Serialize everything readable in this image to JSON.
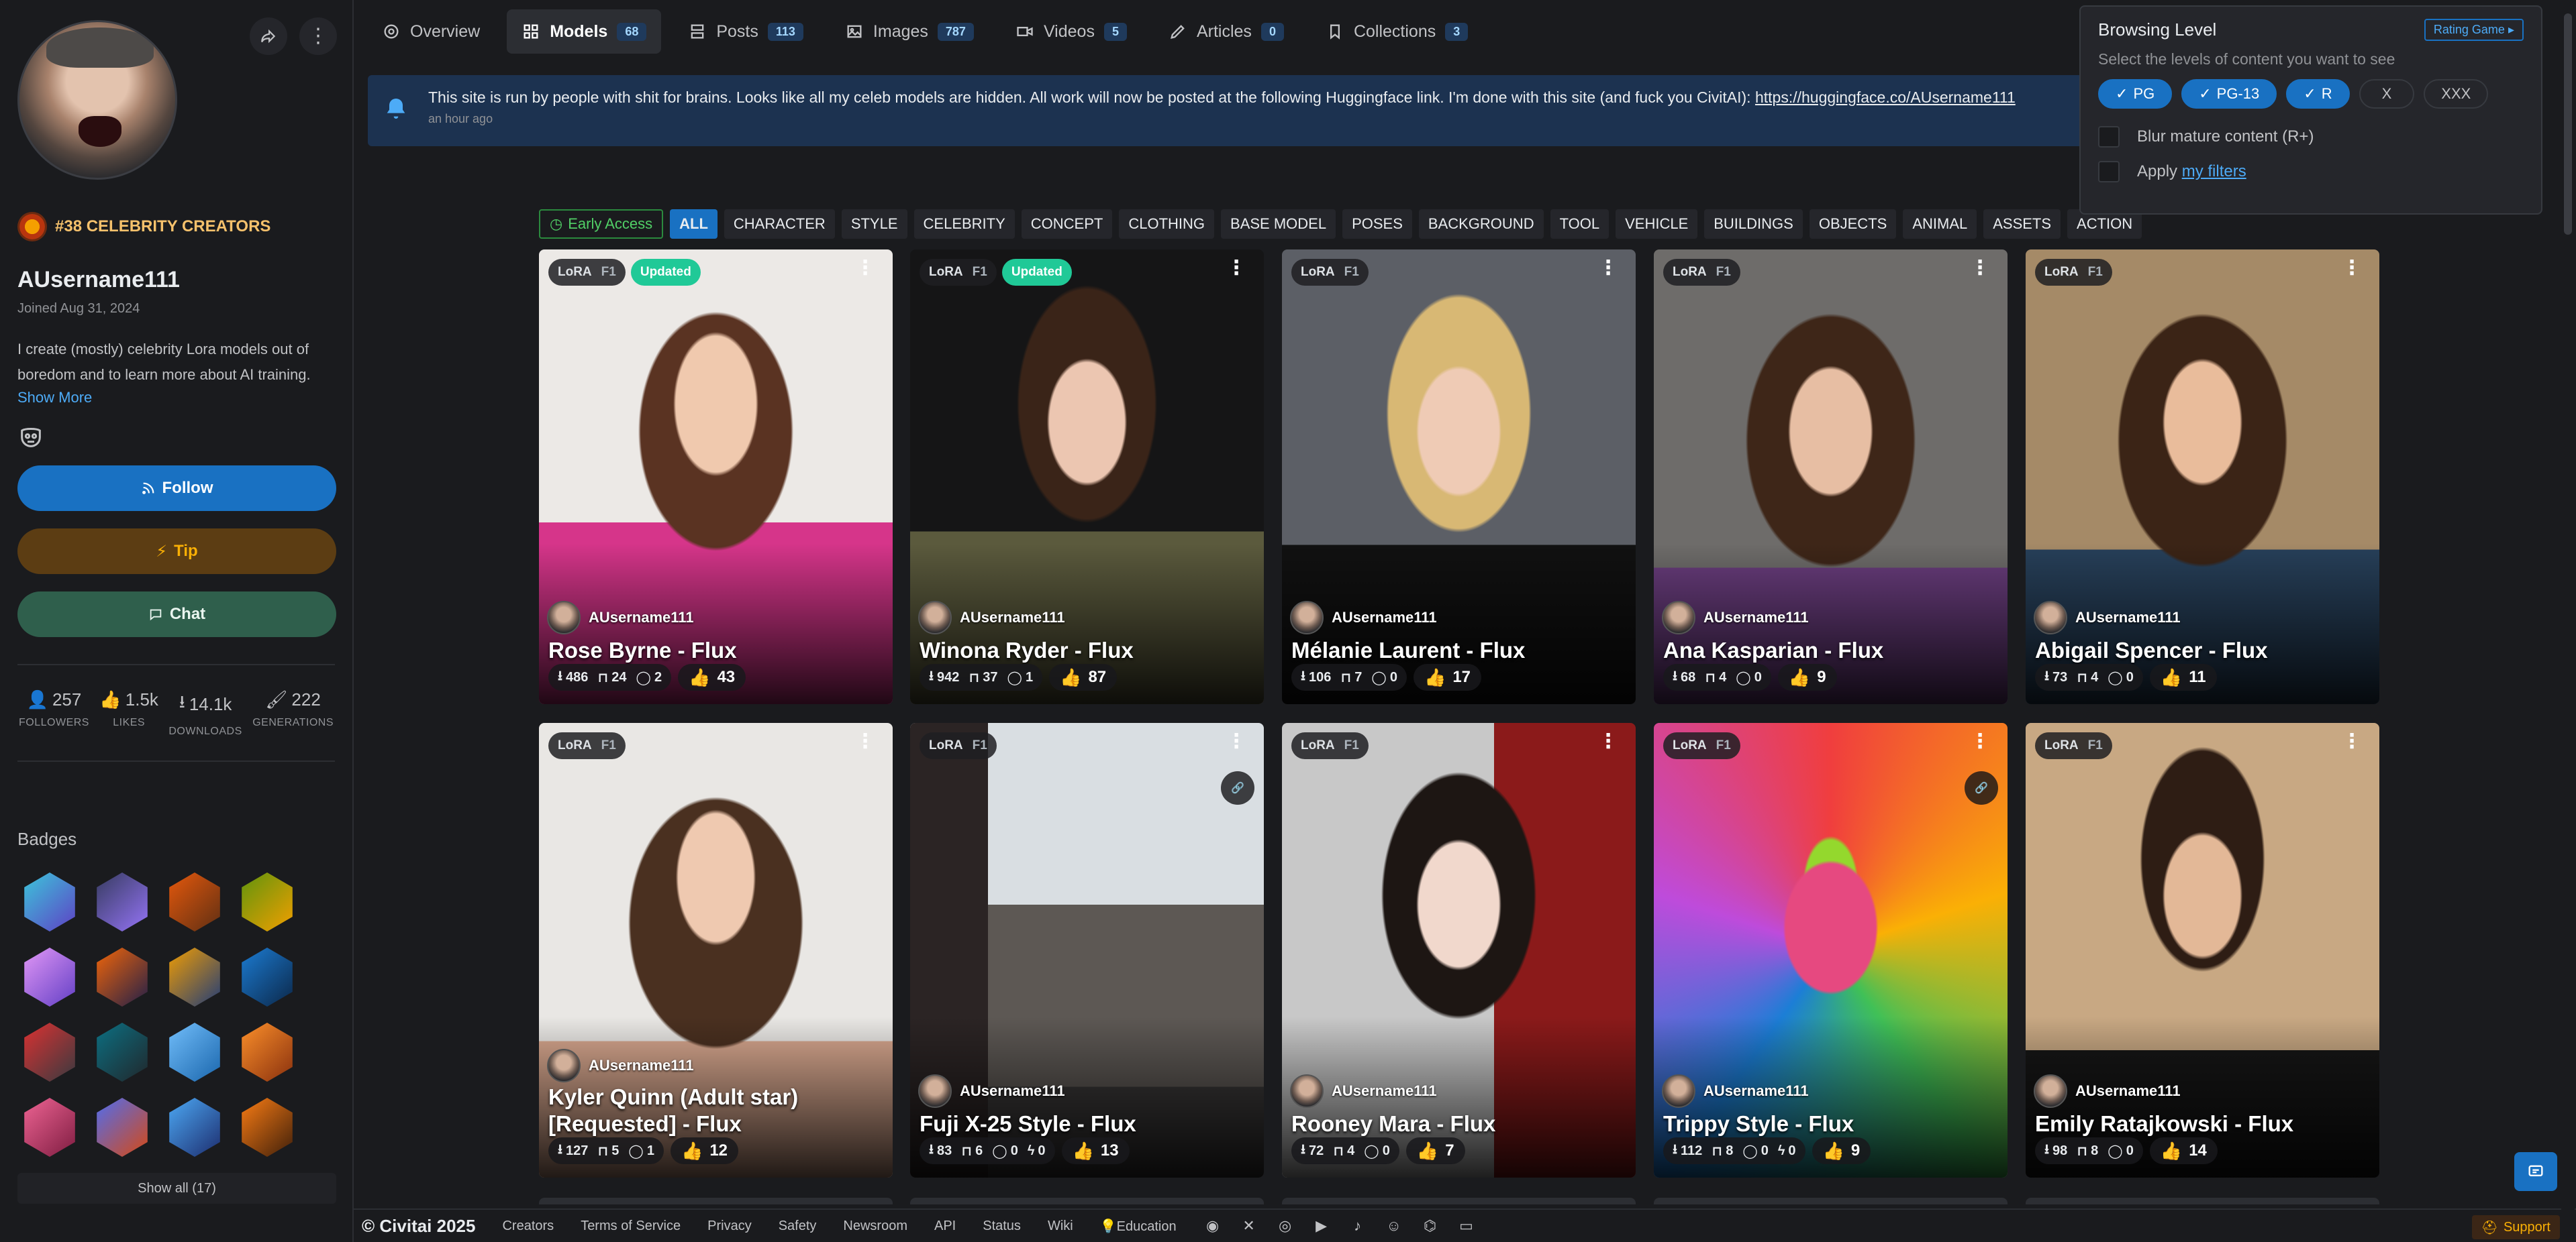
{
  "profile": {
    "rank": "#38 CELEBRITY CREATORS",
    "username": "AUsername111",
    "joined": "Joined Aug 31, 2024",
    "bio": "I create (mostly) celebrity Lora models out of boredom and to learn more about AI training.",
    "show_more": "Show More",
    "follow": "Follow",
    "tip": "Tip",
    "chat": "Chat",
    "stats": [
      {
        "value": "257",
        "label": "FOLLOWERS"
      },
      {
        "value": "1.5k",
        "label": "LIKES"
      },
      {
        "value": "14.1k",
        "label": "DOWNLOADS"
      },
      {
        "value": "222",
        "label": "GENERATIONS"
      }
    ],
    "badges_title": "Badges",
    "show_all": "Show all (17)"
  },
  "tabs": [
    {
      "label": "Overview",
      "count": ""
    },
    {
      "label": "Models",
      "count": "68"
    },
    {
      "label": "Posts",
      "count": "113"
    },
    {
      "label": "Images",
      "count": "787"
    },
    {
      "label": "Videos",
      "count": "5"
    },
    {
      "label": "Articles",
      "count": "0"
    },
    {
      "label": "Collections",
      "count": "3"
    }
  ],
  "announcement": {
    "message": "This site is run by people with shit for brains. Looks like all my celeb models are hidden. All work will now be posted at the following Huggingface link. I'm done with this site (and fuck you CivitAI): ",
    "link": "https://huggingface.co/AUsername111",
    "time": "an hour ago"
  },
  "filters": {
    "early_access": "Early Access",
    "chips": [
      "ALL",
      "CHARACTER",
      "STYLE",
      "CELEBRITY",
      "CONCEPT",
      "CLOTHING",
      "BASE MODEL",
      "POSES",
      "BACKGROUND",
      "TOOL",
      "VEHICLE",
      "BUILDINGS",
      "OBJECTS",
      "ANIMAL",
      "ASSETS",
      "ACTION"
    ]
  },
  "browsing": {
    "title": "Browsing Level",
    "rating_game": "Rating Game",
    "subtitle": "Select the levels of content you want to see",
    "levels": [
      "PG",
      "PG-13",
      "R",
      "X",
      "XXX"
    ],
    "blur": "Blur mature content (R+)",
    "apply": "Apply ",
    "my_filters": "my filters"
  },
  "cards": [
    {
      "type": "LoRA",
      "base": "F1",
      "updated": "Updated",
      "creator": "AUsername111",
      "title": "Rose Byrne - Flux",
      "downloads": "486",
      "bookmarks": "24",
      "comments": "2",
      "tips": "",
      "likes": "43"
    },
    {
      "type": "LoRA",
      "base": "F1",
      "updated": "Updated",
      "creator": "AUsername111",
      "title": "Winona Ryder - Flux",
      "downloads": "942",
      "bookmarks": "37",
      "comments": "1",
      "tips": "",
      "likes": "87"
    },
    {
      "type": "LoRA",
      "base": "F1",
      "updated": "",
      "creator": "AUsername111",
      "title": "Mélanie Laurent - Flux",
      "downloads": "106",
      "bookmarks": "7",
      "comments": "0",
      "tips": "",
      "likes": "17"
    },
    {
      "type": "LoRA",
      "base": "F1",
      "updated": "",
      "creator": "AUsername111",
      "title": "Ana Kasparian - Flux",
      "downloads": "68",
      "bookmarks": "4",
      "comments": "0",
      "tips": "",
      "likes": "9"
    },
    {
      "type": "LoRA",
      "base": "F1",
      "updated": "",
      "creator": "AUsername111",
      "title": "Abigail Spencer - Flux",
      "downloads": "73",
      "bookmarks": "4",
      "comments": "0",
      "tips": "",
      "likes": "11"
    },
    {
      "type": "LoRA",
      "base": "F1",
      "updated": "",
      "creator": "AUsername111",
      "title": "Kyler Quinn (Adult star) [Requested] - Flux",
      "downloads": "127",
      "bookmarks": "5",
      "comments": "1",
      "tips": "",
      "likes": "12"
    },
    {
      "type": "LoRA",
      "base": "F1",
      "updated": "",
      "creator": "AUsername111",
      "title": "Fuji X-25 Style - Flux",
      "downloads": "83",
      "bookmarks": "6",
      "comments": "0",
      "tips": "0",
      "likes": "13"
    },
    {
      "type": "LoRA",
      "base": "F1",
      "updated": "",
      "creator": "AUsername111",
      "title": "Rooney Mara - Flux",
      "downloads": "72",
      "bookmarks": "4",
      "comments": "0",
      "tips": "",
      "likes": "7"
    },
    {
      "type": "LoRA",
      "base": "F1",
      "updated": "",
      "creator": "AUsername111",
      "title": "Trippy Style - Flux",
      "downloads": "112",
      "bookmarks": "8",
      "comments": "0",
      "tips": "0",
      "likes": "9"
    },
    {
      "type": "LoRA",
      "base": "F1",
      "updated": "",
      "creator": "AUsername111",
      "title": "Emily Ratajkowski - Flux",
      "downloads": "98",
      "bookmarks": "8",
      "comments": "0",
      "tips": "",
      "likes": "14"
    }
  ],
  "footer": {
    "copyright": "© Civitai 2025",
    "links": [
      "Creators",
      "Terms of Service",
      "Privacy",
      "Safety",
      "Newsroom",
      "API",
      "Status",
      "Wiki",
      "Education"
    ],
    "support": "Support"
  },
  "colors": {
    "accent": "#1971c2",
    "background": "#1a1b1e",
    "updated_badge": "#20c997",
    "like_thumb": "#fab005"
  }
}
